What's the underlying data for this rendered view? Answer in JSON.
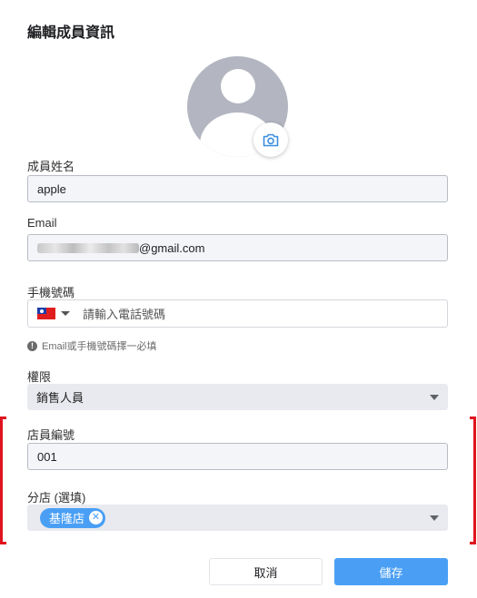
{
  "dialog": {
    "title": "編輯成員資訊"
  },
  "avatar": {
    "camera_icon": "camera-icon"
  },
  "name_field": {
    "label": "成員姓名",
    "value": "apple"
  },
  "email_field": {
    "label": "Email",
    "value_suffix": "@gmail.com"
  },
  "phone_field": {
    "label": "手機號碼",
    "country_icon": "taiwan-flag-icon",
    "placeholder": "請輸入電話號碼"
  },
  "hint": {
    "text": "Email或手機號碼擇一必填"
  },
  "role_field": {
    "label": "權限",
    "value": "銷售人員"
  },
  "staff_id_field": {
    "label": "店員編號",
    "value": "001"
  },
  "branch_field": {
    "label": "分店 (選填)",
    "chips": [
      {
        "label": "基隆店"
      }
    ]
  },
  "actions": {
    "cancel_label": "取消",
    "save_label": "儲存"
  },
  "colors": {
    "primary": "#4a9ff5",
    "highlight": "#e0141e",
    "avatar_bg": "#b3b6c0"
  }
}
